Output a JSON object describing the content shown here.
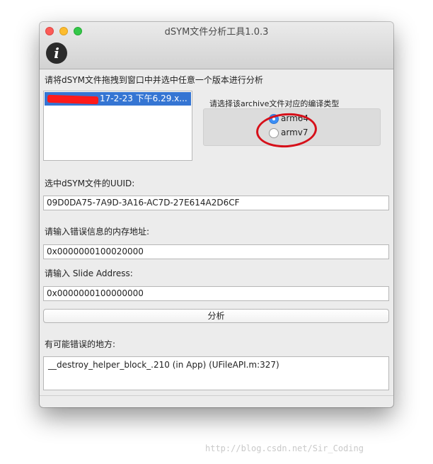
{
  "window": {
    "title": "dSYM文件分析工具1.0.3",
    "info_icon": "info-icon",
    "info_glyph": "i"
  },
  "drop": {
    "instruction": "请将dSYM文件拖拽到窗口中并选中任意一个版本进行分析",
    "items": [
      {
        "label": "17-2-23 下午6.29.x...",
        "selected": true,
        "redacted_prefix": true
      }
    ]
  },
  "arch": {
    "group_label": "请选择该archive文件对应的编译类型",
    "options": [
      {
        "label": "arm64",
        "selected": true
      },
      {
        "label": "armv7",
        "selected": false
      }
    ]
  },
  "uuid": {
    "label": "选中dSYM文件的UUID:",
    "value": "09D0DA75-7A9D-3A16-AC7D-27E614A2D6CF"
  },
  "mem_addr": {
    "label": "请输入错误信息的内存地址:",
    "value": "0x0000000100020000"
  },
  "slide": {
    "label": "请输入 Slide Address:",
    "value": "0x0000000100000000"
  },
  "analyze_button": "分析",
  "result": {
    "label": "有可能错误的地方:",
    "value": "__destroy_helper_block_.210 (in App) (UFileAPI.m:327)"
  },
  "watermark": "http://blog.csdn.net/Sir_Coding",
  "colors": {
    "selection": "#3575d3",
    "radio_on": "#3a8ef6",
    "annotation_red": "#d6101a"
  }
}
